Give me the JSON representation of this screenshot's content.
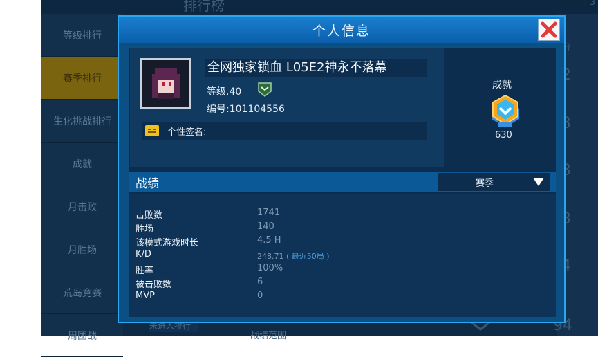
{
  "background": {
    "header_title": "排行榜",
    "header_right": "ㄒ3",
    "sidebar_items": [
      {
        "label": "等级排行",
        "active": false
      },
      {
        "label": "赛季排行",
        "active": true
      },
      {
        "label": "生化挑战排行",
        "active": false
      },
      {
        "label": "成就",
        "active": false
      },
      {
        "label": "月击败",
        "active": false
      },
      {
        "label": "月胜场",
        "active": false
      },
      {
        "label": "荒岛竞赛",
        "active": false
      },
      {
        "label": "周团战",
        "active": false
      }
    ],
    "right_numbers": [
      "分",
      "2",
      "3",
      "3",
      "3",
      "4",
      "94"
    ],
    "bottom_text": "未进入排行",
    "bottom_text2": "战绩范围"
  },
  "modal": {
    "title": "个人信息",
    "close_icon": "close-icon",
    "profile": {
      "name": "全网独家锁血 L05E2神永不落幕",
      "level": "等级.40",
      "uid": "编号:101104556",
      "signature_label": "个性签名:"
    },
    "achievement": {
      "title": "成就",
      "value": "630"
    },
    "stats": {
      "title": "战绩",
      "season_selected": "赛季",
      "rows": [
        {
          "label": "击败数",
          "value": "1741"
        },
        {
          "label": "胜场",
          "value": "140"
        },
        {
          "label": "该模式游戏时长",
          "value": "4.5 H"
        },
        {
          "label": "K/D",
          "value": "248.71",
          "note": "( 最近50局 )"
        },
        {
          "label": "胜率",
          "value": "100%"
        },
        {
          "label": "被击败数",
          "value": "6"
        },
        {
          "label": "MVP",
          "value": "0"
        }
      ]
    }
  },
  "colors": {
    "accent": "#2aa7f0",
    "header": "#0b5fab",
    "close": "#e53935",
    "signature_icon": "#f1c21b"
  }
}
